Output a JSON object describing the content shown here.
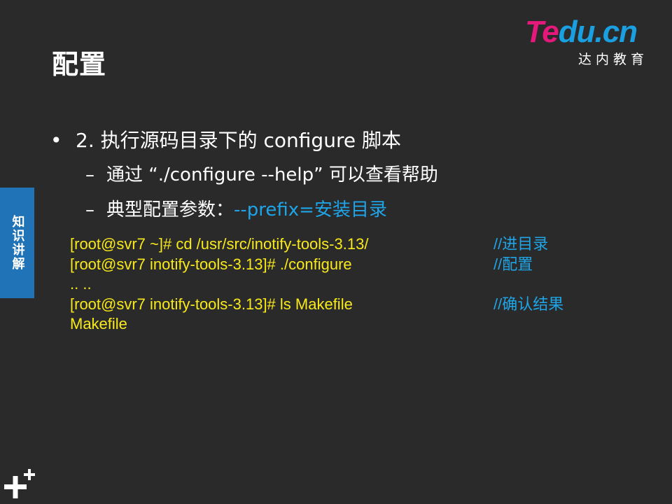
{
  "slide": {
    "title": "配置",
    "side_tab_label": "知识讲解"
  },
  "logo": {
    "part1": "Te",
    "part2": "du.cn",
    "subtitle": "达内教育"
  },
  "bullets": {
    "level1": {
      "marker": "•",
      "text": "2. 执行源码目录下的 configure 脚本"
    },
    "level2": [
      {
        "marker": "–",
        "text": "通过 “./configure --help” 可以查看帮助",
        "accent": ""
      },
      {
        "marker": "–",
        "text": "典型配置参数：",
        "accent": "--prefix=安装目录"
      }
    ]
  },
  "code": [
    {
      "command": "[root@svr7 ~]# cd  /usr/src/inotify-tools-3.13/",
      "comment": "//进目录"
    },
    {
      "command": "[root@svr7 inotify-tools-3.13]#  ./configure",
      "comment": "//配置"
    },
    {
      "command": ".. ..",
      "comment": ""
    },
    {
      "command": "[root@svr7 inotify-tools-3.13]#  ls  Makefile",
      "comment": "//确认结果"
    },
    {
      "command": "Makefile",
      "comment": ""
    }
  ],
  "colors": {
    "background": "#2b2a2b",
    "code_text": "#f8e91b",
    "accent_blue": "#1ea5e8",
    "side_tab": "#1f73b6",
    "logo_pink": "#e5187c"
  },
  "icons": {
    "bottom_left": "plus-plus-icon"
  }
}
